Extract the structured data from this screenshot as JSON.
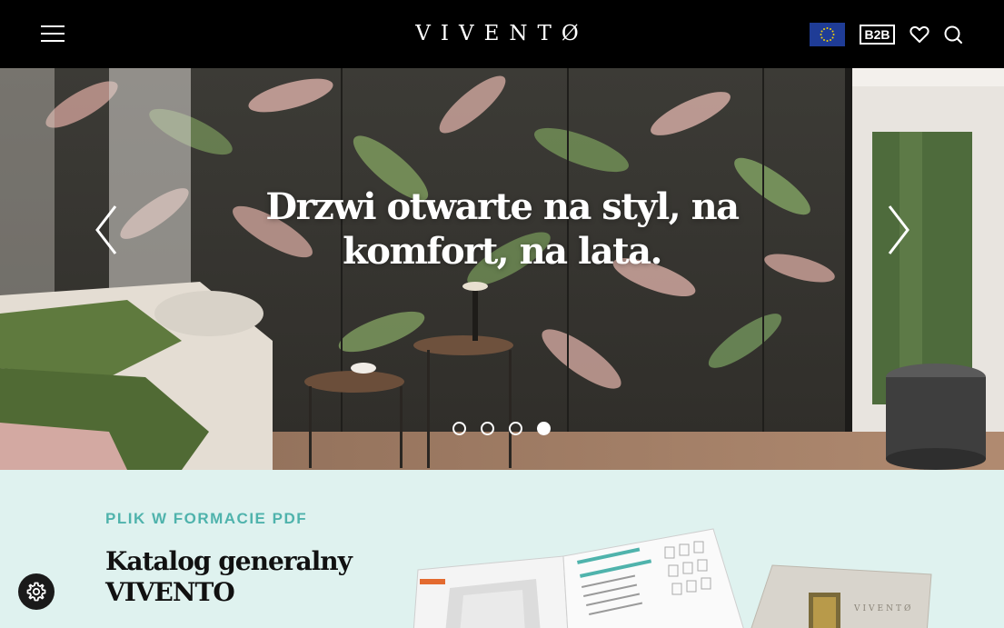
{
  "header": {
    "logo_text": "VIVENTØ",
    "b2b_label": "B2B",
    "icons": [
      "menu-icon",
      "eu-flag-icon",
      "heart-icon",
      "search-icon"
    ]
  },
  "hero": {
    "title": "Drzwi otwarte na styl, na komfort, na lata.",
    "slides_total": 4,
    "active_slide": 4
  },
  "catalog": {
    "label": "PLIK W FORMACIE PDF",
    "title": "Katalog generalny VIVENTO"
  },
  "colors": {
    "header_bg": "#000000",
    "accent_teal": "#4fb3ac",
    "section_bg": "#dff2ef",
    "eu_blue": "#1f3c96"
  }
}
